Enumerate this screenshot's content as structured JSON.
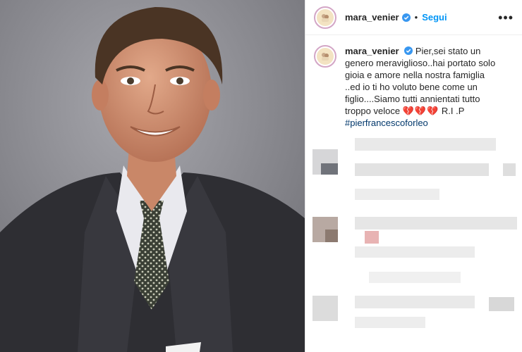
{
  "post": {
    "username": "mara_venier",
    "follow_label": "Segui",
    "more_icon": "•••",
    "separator": "•"
  },
  "caption": {
    "username": "mara_venier",
    "text": "Pier,sei stato un genero meraviglioso..hai portato solo gioia e amore nella nostra famiglia ..ed io ti ho voluto bene come un figlio....Siamo tutti annientati tutto troppo veloce",
    "hearts": "💔💔💔",
    "rip": "R.I .P",
    "hashtag": "#pierfrancescoforleo"
  },
  "colors": {
    "link_blue": "#0095f6",
    "hashtag": "#00376b",
    "verified": "#3897f0"
  }
}
